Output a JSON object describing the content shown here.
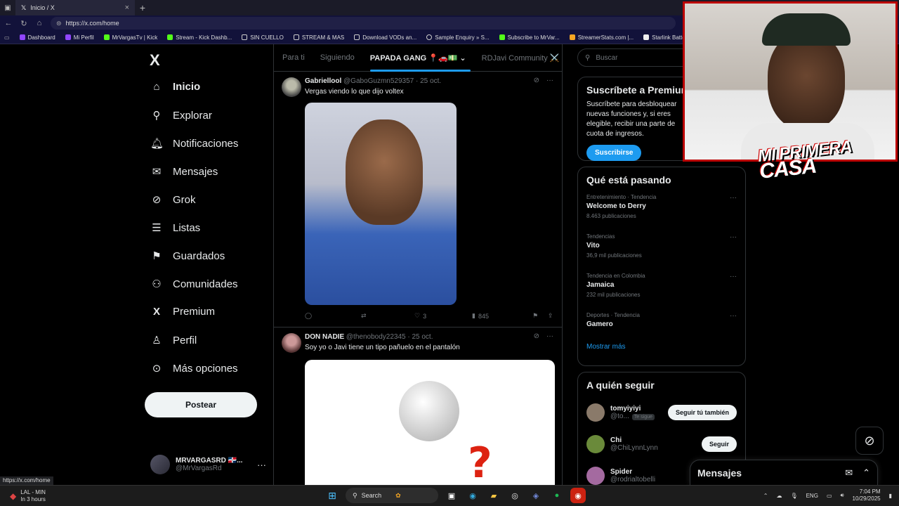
{
  "browser": {
    "tab_title": "Inicio / X",
    "new_tab": "+",
    "url": "https://x.com/home",
    "bookmarks": [
      "Dashboard",
      "Mi Perfil",
      "MrVargasTv | Kick",
      "Stream - Kick Dashb...",
      "SIN CUELLO",
      "STREAM & MAS",
      "Download VODs an...",
      "Sample Enquiry » S...",
      "Subscribe to MrVar...",
      "StreamerStats.com |...",
      "Starlink Battery Pow..."
    ]
  },
  "nav": {
    "logo": "X",
    "items": [
      {
        "label": "Inicio",
        "icon": "home-icon"
      },
      {
        "label": "Explorar",
        "icon": "search-icon"
      },
      {
        "label": "Notificaciones",
        "icon": "bell-icon"
      },
      {
        "label": "Mensajes",
        "icon": "mail-icon"
      },
      {
        "label": "Grok",
        "icon": "grok-icon"
      },
      {
        "label": "Listas",
        "icon": "list-icon"
      },
      {
        "label": "Guardados",
        "icon": "bookmark-icon"
      },
      {
        "label": "Comunidades",
        "icon": "people-icon"
      },
      {
        "label": "Premium",
        "icon": "x-icon"
      },
      {
        "label": "Perfil",
        "icon": "person-icon"
      },
      {
        "label": "Más opciones",
        "icon": "more-circle-icon"
      }
    ],
    "post_button": "Postear",
    "account": {
      "name": "MRVARGASRD 🇩🇴...",
      "handle": "@MrVargasRd",
      "more": "···"
    }
  },
  "feed": {
    "tabs": [
      "Para ti",
      "Siguiendo",
      "PAPADA GANG 📍🚗💵",
      "RDJavi Community ⚔️"
    ],
    "tweets": [
      {
        "name": "Gabriellool",
        "handle": "@GaboGuzmn529357 · 25 oct.",
        "text": "Vergas viendo lo que dijo voltex",
        "replies": "",
        "retweets": "",
        "likes": "3",
        "views": "845"
      },
      {
        "name": "DON NADIE",
        "handle": "@thenobody22345 · 25 oct.",
        "text": "Soy yo o Javi tiene un tipo pañuelo en el pantalón"
      }
    ]
  },
  "sidebar": {
    "search_placeholder": "Buscar",
    "premium": {
      "title": "Suscríbete a Premium",
      "body": "Suscríbete para desbloquear nuevas funciones y, si eres elegible, recibir una parte de cuota de ingresos.",
      "button": "Suscribirse"
    },
    "trends": {
      "title": "Qué está pasando",
      "items": [
        {
          "context": "Entretenimiento · Tendencia",
          "title": "Welcome to Derry",
          "count": "8.463 publicaciones"
        },
        {
          "context": "Tendencias",
          "title": "Vito",
          "count": "36,9 mil publicaciones"
        },
        {
          "context": "Tendencia en Colombia",
          "title": "Jamaica",
          "count": "232 mil publicaciones"
        },
        {
          "context": "Deportes · Tendencia",
          "title": "Gamero",
          "count": ""
        }
      ],
      "show_more": "Mostrar más"
    },
    "who_to_follow": {
      "title": "A quién seguir",
      "items": [
        {
          "name": "tomyiyiyi",
          "handle": "@to...",
          "badge": "Te sigue",
          "button": "Seguir tú también"
        },
        {
          "name": "Chi",
          "handle": "@ChiLynnLynn",
          "badge": "",
          "button": "Seguir"
        },
        {
          "name": "Spider",
          "handle": "@rodrialtobelli",
          "badge": "",
          "button": ""
        }
      ]
    }
  },
  "messages": {
    "title": "Mensajes"
  },
  "overlay": {
    "text_line1": "MI PRIMERA",
    "text_line2": "CASA"
  },
  "status_url": "https://x.com/home",
  "taskbar": {
    "weather_title": "LAL - MIN",
    "weather_sub": "In 3 hours",
    "search": "Search",
    "lang": "ENG",
    "time": "7:04 PM",
    "date": "10/29/2025"
  }
}
